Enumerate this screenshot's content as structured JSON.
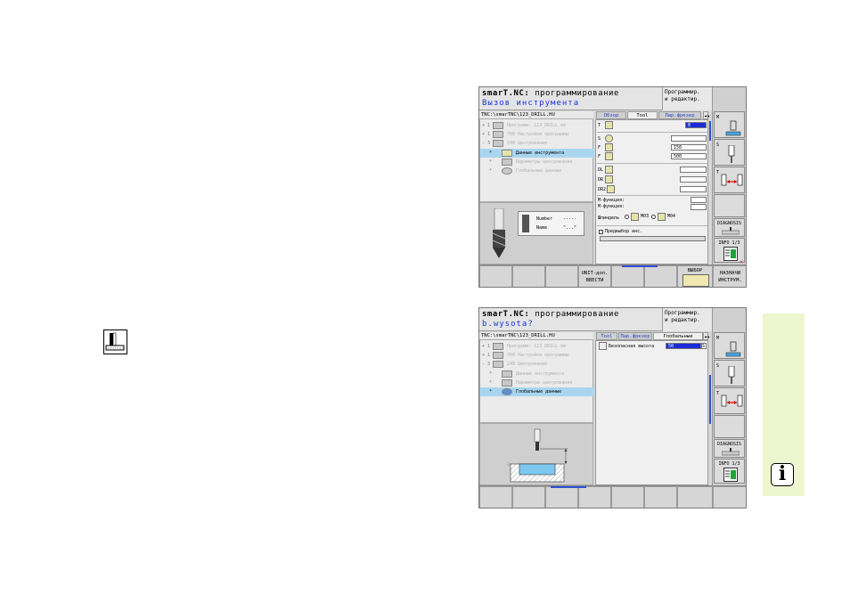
{
  "side_icon": "tool-call-icon",
  "info_button": {
    "label": "i",
    "icon": "info-icon"
  },
  "screen1": {
    "title_app": "smarT.NC:",
    "title_mode": "программирование",
    "subtitle": "Вызов инструмента",
    "mode_box": [
      "Программир.",
      "и редактир."
    ],
    "path": "TNC:\\smarTNC\\123_DRILL.HU",
    "tree": [
      {
        "prefix": "+",
        "num": "1",
        "label": "Программ: 123_DRILL mm",
        "selected": false
      },
      {
        "prefix": "+",
        "num": "1",
        "label": "700 Настройки программы",
        "selected": false
      },
      {
        "prefix": "-",
        "num": "3",
        "label": "240 Центрование",
        "selected": false
      },
      {
        "prefix": "",
        "num": "*",
        "label": "Данные инструмента",
        "selected": true
      },
      {
        "prefix": "",
        "num": "*",
        "label": "Параметры центрования",
        "selected": false
      },
      {
        "prefix": "",
        "num": "*",
        "label": "Глобальные данные",
        "selected": false
      }
    ],
    "preview": {
      "number_label": "Number",
      "number_value": "-----",
      "name_label": "Name",
      "name_value": "\"...\""
    },
    "tabs": [
      "Обзор",
      "Tool",
      "Пар.фрезер"
    ],
    "form": {
      "t_label": "T",
      "t_value": "0",
      "s_label": "S",
      "s_value": "",
      "f_label": "F",
      "f_value": "150",
      "f2_label": "F",
      "f2_value": "500",
      "dl_label": "DL",
      "dr_label": "DR",
      "dr2_label": "DR2",
      "m1_label": "М-функция:",
      "m2_label": "М-функция:",
      "spindle_label": "Шпиндель",
      "m03": "M03",
      "m04": "M04",
      "preselect_label": "Предвыбор инс."
    },
    "side_keys": [
      "M",
      "S",
      "T",
      "",
      "DIAGNOSIS",
      "INFO 1/3"
    ],
    "bottom_keys": [
      "",
      "",
      "",
      "UNIT-доп. ВВЕСТИ",
      "",
      "",
      "ВЫБОР",
      "НАЗНАЧИ ИНСТРУМ."
    ]
  },
  "screen2": {
    "title_app": "smarT.NC:",
    "title_mode": "программирование",
    "subtitle": "b.wysota?",
    "mode_box": [
      "Программир.",
      "и редактир."
    ],
    "path": "TNC:\\smarTNC\\123_DRILL.HU",
    "tree": [
      {
        "prefix": "+",
        "num": "1",
        "label": "Программ: 123_DRILL mm",
        "selected": false
      },
      {
        "prefix": "+",
        "num": "1",
        "label": "700 Настройки программы",
        "selected": false
      },
      {
        "prefix": "-",
        "num": "3",
        "label": "240 Центрование",
        "selected": false
      },
      {
        "prefix": "",
        "num": "*",
        "label": "Данные инструмента",
        "selected": false
      },
      {
        "prefix": "",
        "num": "*",
        "label": "Параметры центрования",
        "selected": false
      },
      {
        "prefix": "",
        "num": "*",
        "label": "Глобальные данные",
        "selected": true
      }
    ],
    "tabs": [
      "Tool",
      "Пар.фрезер",
      "Глобальные данные"
    ],
    "form": {
      "height_label": "Безопасная высота",
      "height_value": "50"
    },
    "side_keys": [
      "M",
      "S",
      "T",
      "",
      "DIAGNOSIS",
      "INFO 1/3"
    ],
    "bottom_keys": [
      "",
      "",
      "",
      "",
      "",
      "",
      "",
      ""
    ]
  }
}
